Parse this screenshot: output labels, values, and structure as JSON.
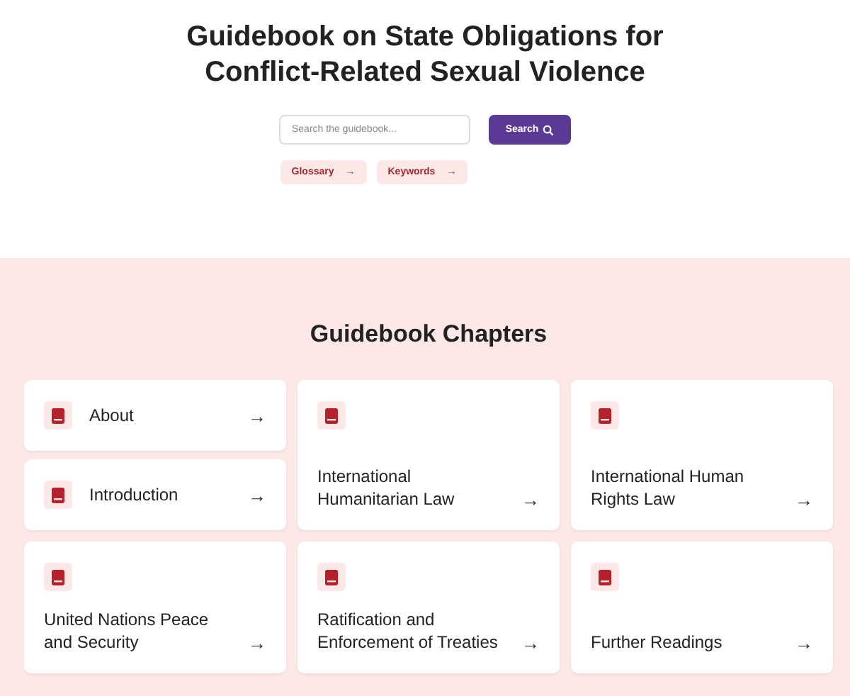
{
  "title": "Guidebook on State Obligations for Conflict-Related Sexual Violence",
  "search": {
    "placeholder": "Search the guidebook...",
    "button": "Search"
  },
  "links": [
    {
      "label": "Glossary",
      "arrow": "→"
    },
    {
      "label": "Keywords",
      "arrow": "→"
    }
  ],
  "chapters_heading": "Guidebook Chapters",
  "chapters": [
    {
      "kind": "compact",
      "title": "About",
      "arrow": "→"
    },
    {
      "kind": "compact",
      "title": "Introduction",
      "arrow": "→"
    },
    {
      "kind": "tall",
      "title": "International Humanitarian Law",
      "arrow": "→"
    },
    {
      "kind": "tall",
      "title": "International Human Rights Law",
      "arrow": "→"
    },
    {
      "kind": "tall",
      "title": "United Nations Peace and Security",
      "arrow": "→"
    },
    {
      "kind": "tall",
      "title": "Ratification and Enforcement of Treaties",
      "arrow": "→"
    },
    {
      "kind": "tall",
      "title": "Further Readings",
      "arrow": "→"
    }
  ]
}
